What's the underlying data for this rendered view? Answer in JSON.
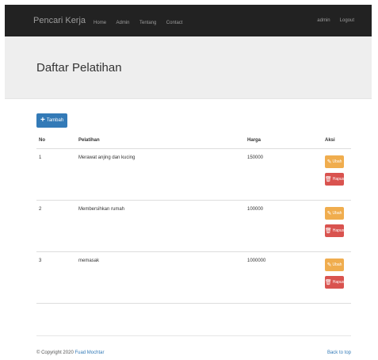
{
  "nav": {
    "brand": "Pencari Kerja",
    "links": [
      "Home",
      "Admin",
      "Tentang",
      "Contact"
    ],
    "right": [
      "admin",
      "Logout"
    ]
  },
  "page": {
    "title": "Daftar Pelatihan"
  },
  "toolbar": {
    "add_label": "Tambah"
  },
  "table": {
    "headers": [
      "No",
      "Pelatihan",
      "Harga",
      "Aksi"
    ],
    "rows": [
      {
        "no": "1",
        "pelatihan": "Merawat anjing dan kucing",
        "harga": "150000"
      },
      {
        "no": "2",
        "pelatihan": "Membersihkan rumah",
        "harga": "100000"
      },
      {
        "no": "3",
        "pelatihan": "memasak",
        "harga": "1000000"
      }
    ],
    "edit_label": "Ubah",
    "delete_label": "Hapus"
  },
  "footer": {
    "copyright": "© Copyright 2020",
    "author": "Fuad Mochtar",
    "back_to_top": "Back to top"
  },
  "colors": {
    "primary": "#337ab7",
    "warning": "#f0ad4e",
    "danger": "#d9534f",
    "navbar": "#222222"
  }
}
